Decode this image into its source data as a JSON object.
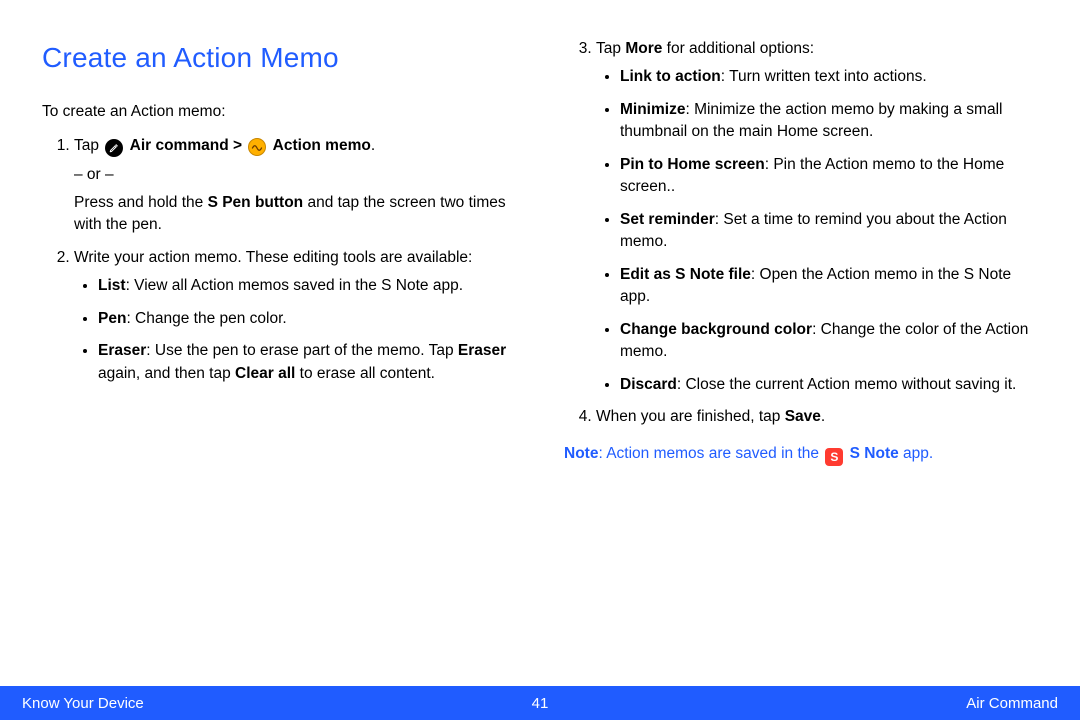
{
  "title": "Create an Action Memo",
  "intro": "To create an Action memo:",
  "step1": {
    "tap": "Tap ",
    "aircmd": "Air command > ",
    "actionmemo": "Action memo",
    "period": ".",
    "or": "– or –",
    "alt_a": "Press and hold the ",
    "alt_b": "S Pen button",
    "alt_c": " and tap the screen two times with the pen."
  },
  "step2": {
    "lead": "Write your action memo. These editing tools are available:",
    "list": {
      "b": "List",
      "t": ": View all Action memos saved in the S Note app."
    },
    "pen": {
      "b": "Pen",
      "t": ": Change the pen color."
    },
    "eraser": {
      "b1": "Eraser",
      "t1": ": Use the pen to erase part of the memo. Tap ",
      "b2": "Eraser",
      "t2": " again, and then tap ",
      "b3": "Clear all",
      "t3": " to erase all content."
    }
  },
  "step3": {
    "lead_a": "Tap ",
    "lead_b": "More",
    "lead_c": " for additional options:",
    "link": {
      "b": "Link to action",
      "t": ": Turn written text into actions."
    },
    "min": {
      "b": "Minimize",
      "t": ": Minimize the action memo by making a small thumbnail on the main Home screen."
    },
    "pin": {
      "b": "Pin to Home screen",
      "t": ": Pin the Action memo to the Home screen.."
    },
    "rem": {
      "b": "Set reminder",
      "t": ": Set a time to remind you about the Action memo."
    },
    "edit": {
      "b": "Edit as S Note file",
      "t": ": Open the Action memo in the S Note app."
    },
    "bg": {
      "b": "Change background color",
      "t": ": Change the color of the Action memo."
    },
    "disc": {
      "b": "Discard",
      "t": ": Close the current Action memo without saving it."
    }
  },
  "step4": {
    "a": "When you are finished, tap ",
    "b": "Save",
    "c": "."
  },
  "note": {
    "label": "Note",
    "sep": ": ",
    "a": "Action memos are saved in the ",
    "b": "S Note",
    "c": " app."
  },
  "footer": {
    "left": "Know Your Device",
    "page": "41",
    "right": "Air Command"
  },
  "icons": {
    "snote_letter": "S"
  }
}
